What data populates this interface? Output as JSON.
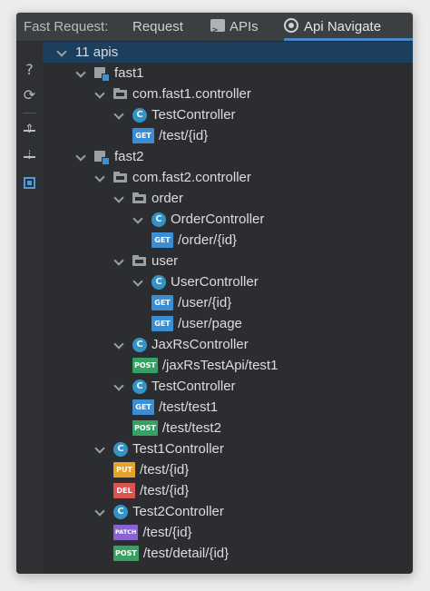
{
  "header": {
    "title": "Fast Request:",
    "tabs": [
      {
        "label": "Request",
        "icon": null
      },
      {
        "label": "APIs",
        "icon": "terminal-icon"
      },
      {
        "label": "Api Navigate",
        "icon": "radio-icon",
        "active": true
      }
    ]
  },
  "toolbar": {
    "help_glyph": "?",
    "refresh_glyph": "⟳",
    "buttons": [
      "help-icon",
      "refresh-icon",
      "expand-all-icon",
      "collapse-all-icon",
      "locate-icon"
    ]
  },
  "colors": {
    "GET": "#3c8ed4",
    "POST": "#36a163",
    "PUT": "#e9a12a",
    "DEL": "#d9534f",
    "PATCH": "#8a63d2",
    "accent": "#4a88c7",
    "selection": "#1c3f5f"
  },
  "tree": [
    {
      "depth": 0,
      "type": "root",
      "label": "11 apis",
      "expanded": true,
      "selected": true
    },
    {
      "depth": 1,
      "type": "module",
      "label": "fast1",
      "expanded": true
    },
    {
      "depth": 2,
      "type": "package",
      "label": "com.fast1.controller",
      "expanded": true
    },
    {
      "depth": 3,
      "type": "class",
      "label": "TestController",
      "expanded": true
    },
    {
      "depth": 4,
      "type": "api",
      "method": "GET",
      "label": "/test/{id}"
    },
    {
      "depth": 1,
      "type": "module",
      "label": "fast2",
      "expanded": true
    },
    {
      "depth": 2,
      "type": "package",
      "label": "com.fast2.controller",
      "expanded": true
    },
    {
      "depth": 3,
      "type": "package",
      "label": "order",
      "expanded": true
    },
    {
      "depth": 4,
      "type": "class",
      "label": "OrderController",
      "expanded": true
    },
    {
      "depth": 5,
      "type": "api",
      "method": "GET",
      "label": "/order/{id}"
    },
    {
      "depth": 3,
      "type": "package",
      "label": "user",
      "expanded": true
    },
    {
      "depth": 4,
      "type": "class",
      "label": "UserController",
      "expanded": true
    },
    {
      "depth": 5,
      "type": "api",
      "method": "GET",
      "label": "/user/{id}"
    },
    {
      "depth": 5,
      "type": "api",
      "method": "GET",
      "label": "/user/page"
    },
    {
      "depth": 3,
      "type": "class",
      "label": "JaxRsController",
      "expanded": true
    },
    {
      "depth": 4,
      "type": "api",
      "method": "POST",
      "label": "/jaxRsTestApi/test1"
    },
    {
      "depth": 3,
      "type": "class",
      "label": "TestController",
      "expanded": true
    },
    {
      "depth": 4,
      "type": "api",
      "method": "GET",
      "label": "/test/test1"
    },
    {
      "depth": 4,
      "type": "api",
      "method": "POST",
      "label": "/test/test2"
    },
    {
      "depth": 2,
      "type": "class",
      "label": "Test1Controller",
      "expanded": true
    },
    {
      "depth": 3,
      "type": "api",
      "method": "PUT",
      "label": "/test/{id}"
    },
    {
      "depth": 3,
      "type": "api",
      "method": "DEL",
      "label": "/test/{id}"
    },
    {
      "depth": 2,
      "type": "class",
      "label": "Test2Controller",
      "expanded": true
    },
    {
      "depth": 3,
      "type": "api",
      "method": "PATCH",
      "label": "/test/{id}"
    },
    {
      "depth": 3,
      "type": "api",
      "method": "POST",
      "label": "/test/detail/{id}"
    }
  ]
}
